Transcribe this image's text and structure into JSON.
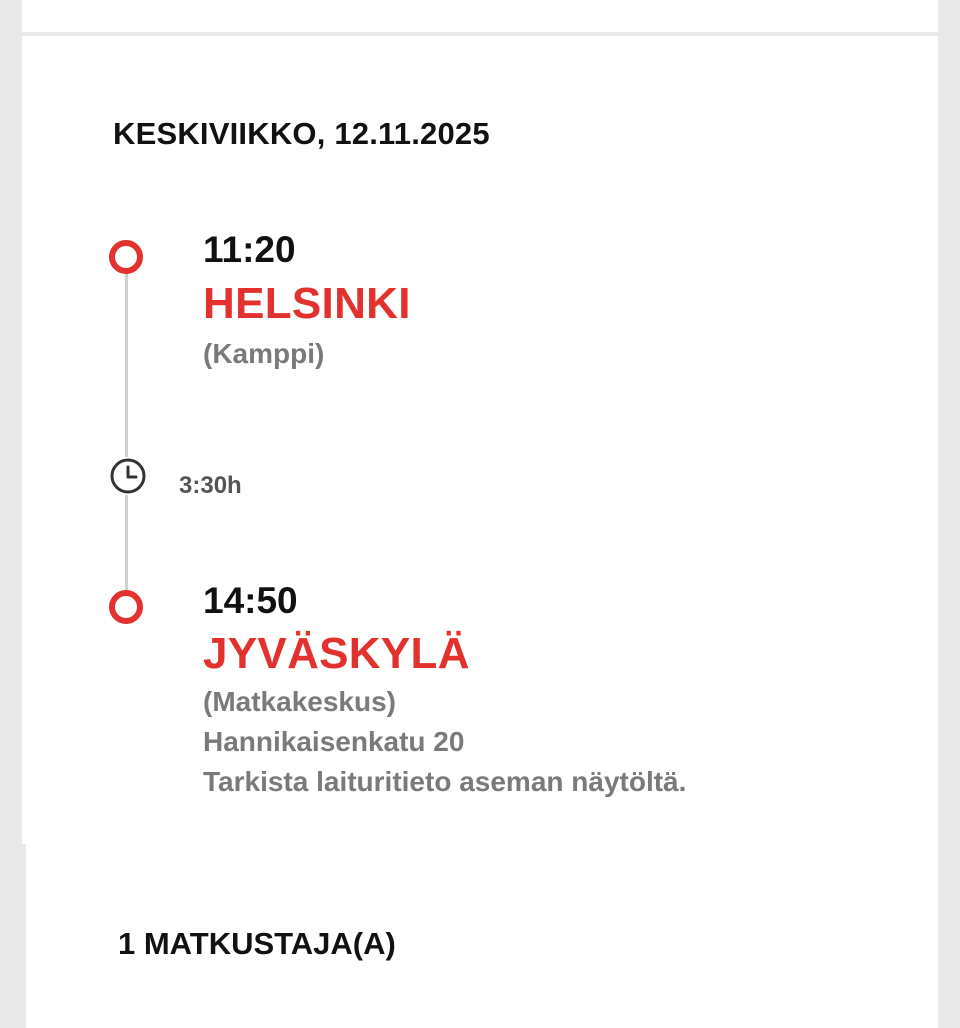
{
  "trip": {
    "date": "KESKIVIIKKO, 12.11.2025",
    "origin": {
      "time": "11:20",
      "city": "HELSINKI",
      "station": "(Kamppi)"
    },
    "duration": "3:30h",
    "destination": {
      "time": "14:50",
      "city": "JYVÄSKYLÄ",
      "station": "(Matkakeskus)",
      "address": "Hannikaisenkatu 20",
      "note": "Tarkista laituritieto aseman näytöltä."
    }
  },
  "passengers": {
    "label": "1 MATKUSTAJA(A)"
  },
  "colors": {
    "accent": "#e3312e",
    "text": "#111111",
    "muted": "#7a7a7a",
    "background": "#e9e9e9"
  },
  "icons": {
    "origin_marker": "circle-marker-icon",
    "duration": "clock-icon",
    "destination_marker": "circle-marker-icon"
  }
}
